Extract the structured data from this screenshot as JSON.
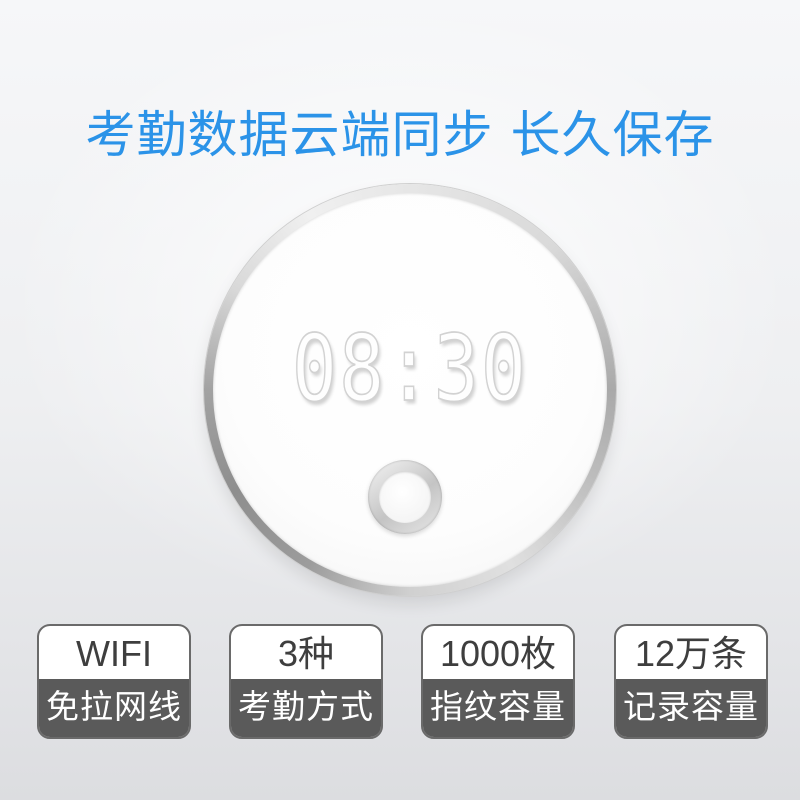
{
  "headline": "考勤数据云端同步 长久保存",
  "device": {
    "display_time": "08:30",
    "sensor_icon": "fingerprint-button"
  },
  "features": [
    {
      "value": "WIFI",
      "label": "免拉网线"
    },
    {
      "value": "3种",
      "label": "考勤方式"
    },
    {
      "value": "1000枚",
      "label": "指纹容量"
    },
    {
      "value": "12万条",
      "label": "记录容量"
    }
  ],
  "colors": {
    "headline": "#2b93e8",
    "badge_label_bg": "#5a5a5a",
    "badge_border": "#6a6a6a"
  }
}
